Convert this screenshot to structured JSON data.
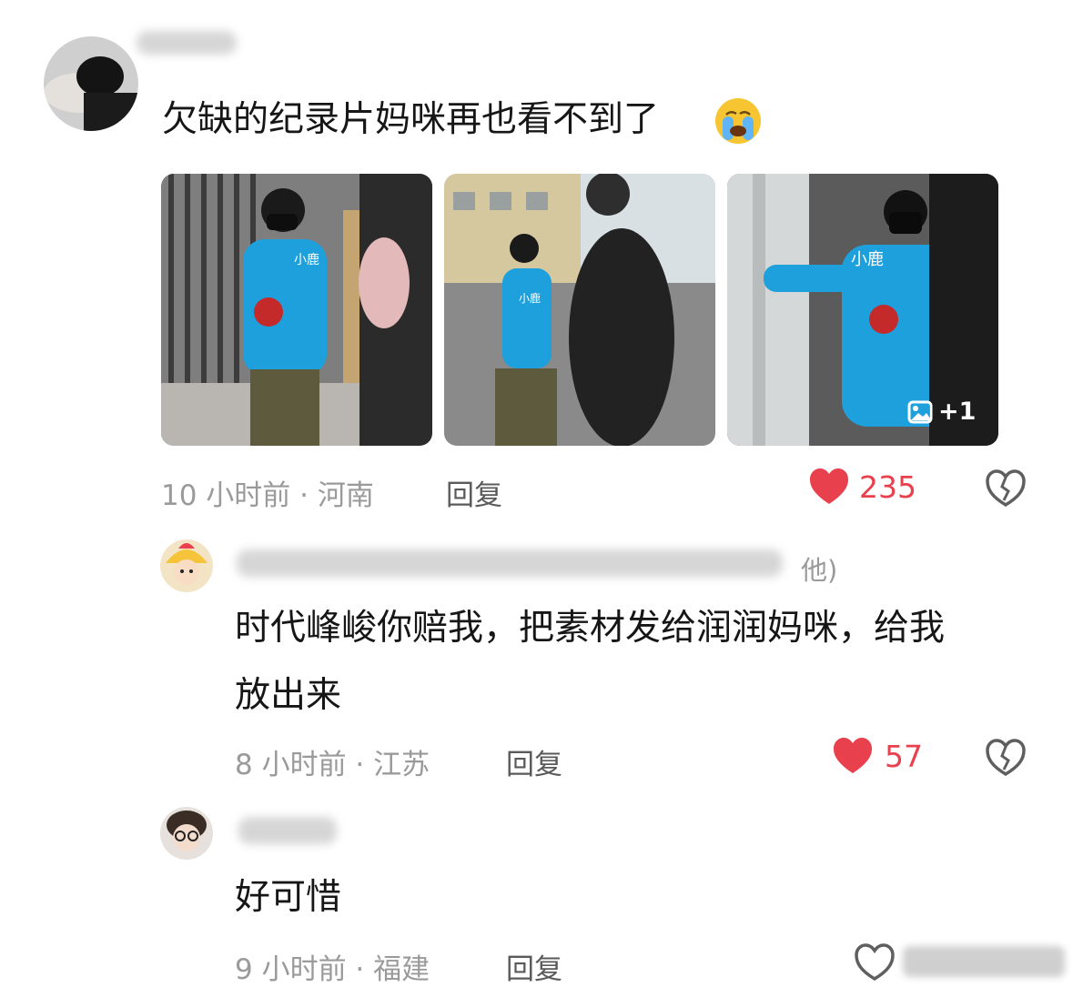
{
  "comment_main": {
    "text": "欠缺的纪录片妈咪再也看不到了",
    "emoji_icon": "crying-face-icon",
    "meta": "10 小时前 · 河南",
    "reply_label": "回复",
    "like_count": "235",
    "liked": true,
    "accent_color": "#e8404c",
    "images_more_badge": "+1",
    "photo_watermark": "小鹿"
  },
  "reply_1": {
    "username_tail": "他)",
    "text_line1": "时代峰峻你赔我，把素材发给润润妈咪，给我",
    "text_line2": "放出来",
    "meta": "8 小时前 · 江苏",
    "reply_label": "回复",
    "like_count": "57",
    "liked": true
  },
  "reply_2": {
    "text": "好可惜",
    "meta": "9 小时前 · 福建",
    "reply_label": "回复",
    "liked": false
  }
}
